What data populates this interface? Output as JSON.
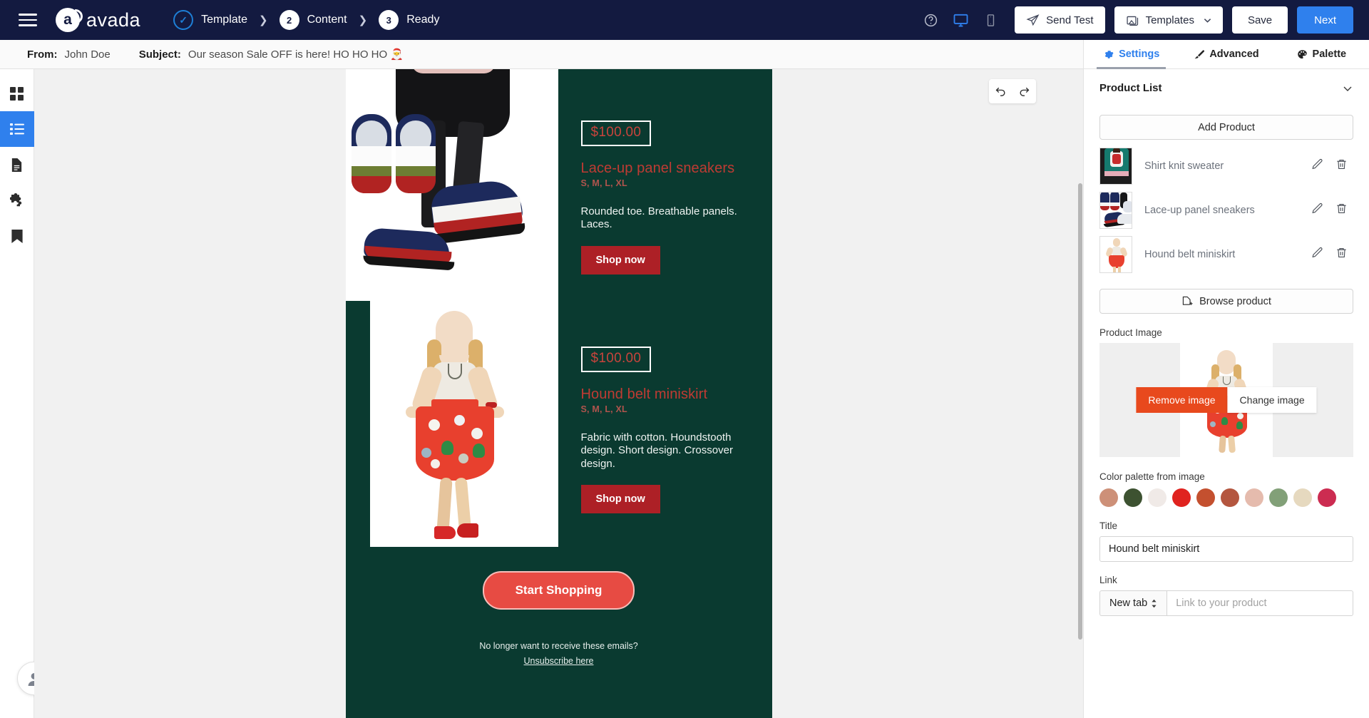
{
  "app": {
    "brand": "avada",
    "steps": [
      {
        "badge": "check",
        "label": "Template"
      },
      {
        "badge": "2",
        "label": "Content"
      },
      {
        "badge": "3",
        "label": "Ready"
      }
    ],
    "toolbar": {
      "help_icon": "help-circle-icon",
      "desktop_icon": "desktop-icon",
      "mobile_icon": "mobile-icon",
      "send_test_label": "Send Test",
      "templates_label": "Templates",
      "save_label": "Save",
      "next_label": "Next",
      "accent": "#2f80ed"
    }
  },
  "subject_bar": {
    "from_label": "From:",
    "from_value": "John Doe",
    "subject_label": "Subject:",
    "subject_value": "Our season Sale OFF is here! HO HO HO 🎅"
  },
  "rail": {
    "items": [
      {
        "icon": "grid-icon",
        "name": "blocks",
        "active": false
      },
      {
        "icon": "list-icon",
        "name": "content-list",
        "active": true
      },
      {
        "icon": "page-icon",
        "name": "page",
        "active": false
      },
      {
        "icon": "puzzle-icon",
        "name": "elements",
        "active": false
      },
      {
        "icon": "bookmark-icon",
        "name": "saved",
        "active": false
      }
    ]
  },
  "canvas": {
    "undo_icon": "undo-icon",
    "redo_icon": "redo-icon",
    "email": {
      "background": "#0a3a30",
      "products": [
        {
          "price": "$100.00",
          "title": "Lace-up panel sneakers",
          "sizes": "S, M, L, XL",
          "description": "Rounded toe. Breathable panels. Laces.",
          "cta": "Shop now"
        },
        {
          "price": "$100.00",
          "title": "Hound belt miniskirt",
          "sizes": "S, M, L, XL",
          "description": "Fabric with cotton. Houndstooth design. Short design. Crossover design.",
          "cta": "Shop now"
        }
      ],
      "footer": {
        "cta": "Start Shopping",
        "note": "No longer want to receive these emails?",
        "unsubscribe": "Unsubscribe here"
      }
    }
  },
  "panel": {
    "tabs": [
      {
        "label": "Settings",
        "icon": "gear-icon",
        "active": true
      },
      {
        "label": "Advanced",
        "icon": "brush-icon",
        "active": false
      },
      {
        "label": "Palette",
        "icon": "palette-icon",
        "active": false
      }
    ],
    "section_title": "Product List",
    "collapse_icon": "chevron-down-icon",
    "add_product_label": "Add Product",
    "products": [
      {
        "name": "Shirt knit sweater",
        "edit_icon": "pencil-icon",
        "delete_icon": "trash-icon"
      },
      {
        "name": "Lace-up panel sneakers",
        "edit_icon": "pencil-icon",
        "delete_icon": "trash-icon"
      },
      {
        "name": "Hound belt miniskirt",
        "edit_icon": "pencil-icon",
        "delete_icon": "trash-icon"
      }
    ],
    "browse_product_label": "Browse product",
    "browse_icon": "tag-plus-icon",
    "product_image_label": "Product Image",
    "remove_image_label": "Remove image",
    "change_image_label": "Change image",
    "palette_label": "Color palette from image",
    "palette_colors": [
      "#cd9078",
      "#3d5231",
      "#f0eae7",
      "#e0231f",
      "#c4502f",
      "#b4563f",
      "#e5bbad",
      "#82a078",
      "#e6d9bf",
      "#cc2c51"
    ],
    "title_label": "Title",
    "title_value": "Hound belt miniskirt",
    "link_label": "Link",
    "link_target": "New tab",
    "link_placeholder": "Link to your product"
  }
}
